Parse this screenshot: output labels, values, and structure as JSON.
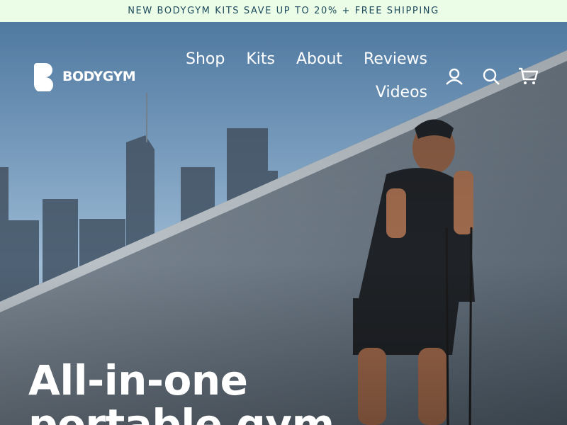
{
  "announcement": {
    "text": "NEW BODYGYM KITS SAVE UP TO 20% + FREE SHIPPING"
  },
  "brand": {
    "name": "BODYGYM",
    "logo_icon": "bodygym-b-icon"
  },
  "nav": {
    "items": [
      {
        "label": "Shop"
      },
      {
        "label": "Kits"
      },
      {
        "label": "About"
      },
      {
        "label": "Reviews"
      },
      {
        "label": "Videos"
      }
    ]
  },
  "header_icons": [
    {
      "name": "account-icon"
    },
    {
      "name": "search-icon"
    },
    {
      "name": "cart-icon"
    }
  ],
  "hero": {
    "headline_line1": "All-in-one",
    "headline_line2": "portable gym"
  },
  "colors": {
    "announcement_bg": "#ebfde7",
    "announcement_text": "#1d4b5c",
    "nav_text": "#ffffff"
  }
}
